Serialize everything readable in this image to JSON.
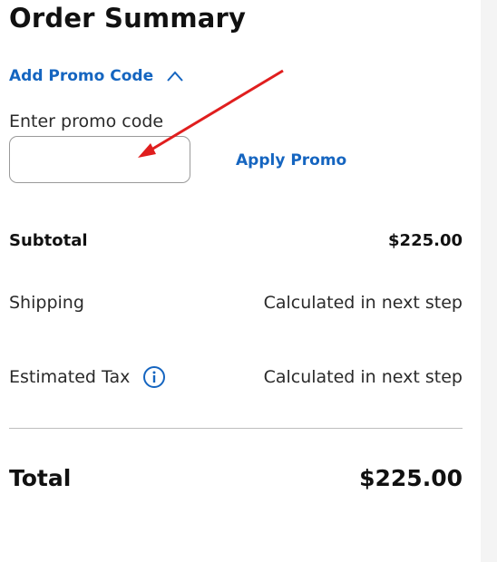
{
  "order_summary": {
    "title": "Order Summary",
    "promo_toggle_label": "Add Promo Code",
    "promo_input_label": "Enter promo code",
    "promo_input_value": "",
    "promo_input_placeholder": "",
    "apply_promo_label": "Apply Promo",
    "rows": {
      "subtotal": {
        "label": "Subtotal",
        "value": "$225.00"
      },
      "shipping": {
        "label": "Shipping",
        "value": "Calculated in next step"
      },
      "estimated_tax": {
        "label": "Estimated Tax",
        "value": "Calculated in next step"
      },
      "total": {
        "label": "Total",
        "value": "$225.00"
      }
    }
  },
  "icons": {
    "promo_toggle": "chevron-up-icon",
    "tax_info": "info-icon"
  },
  "colors": {
    "link_blue": "#1565c0",
    "annotation_red": "#e01e1e",
    "divider": "#bdbdbd",
    "input_border": "#9a9a9a"
  }
}
